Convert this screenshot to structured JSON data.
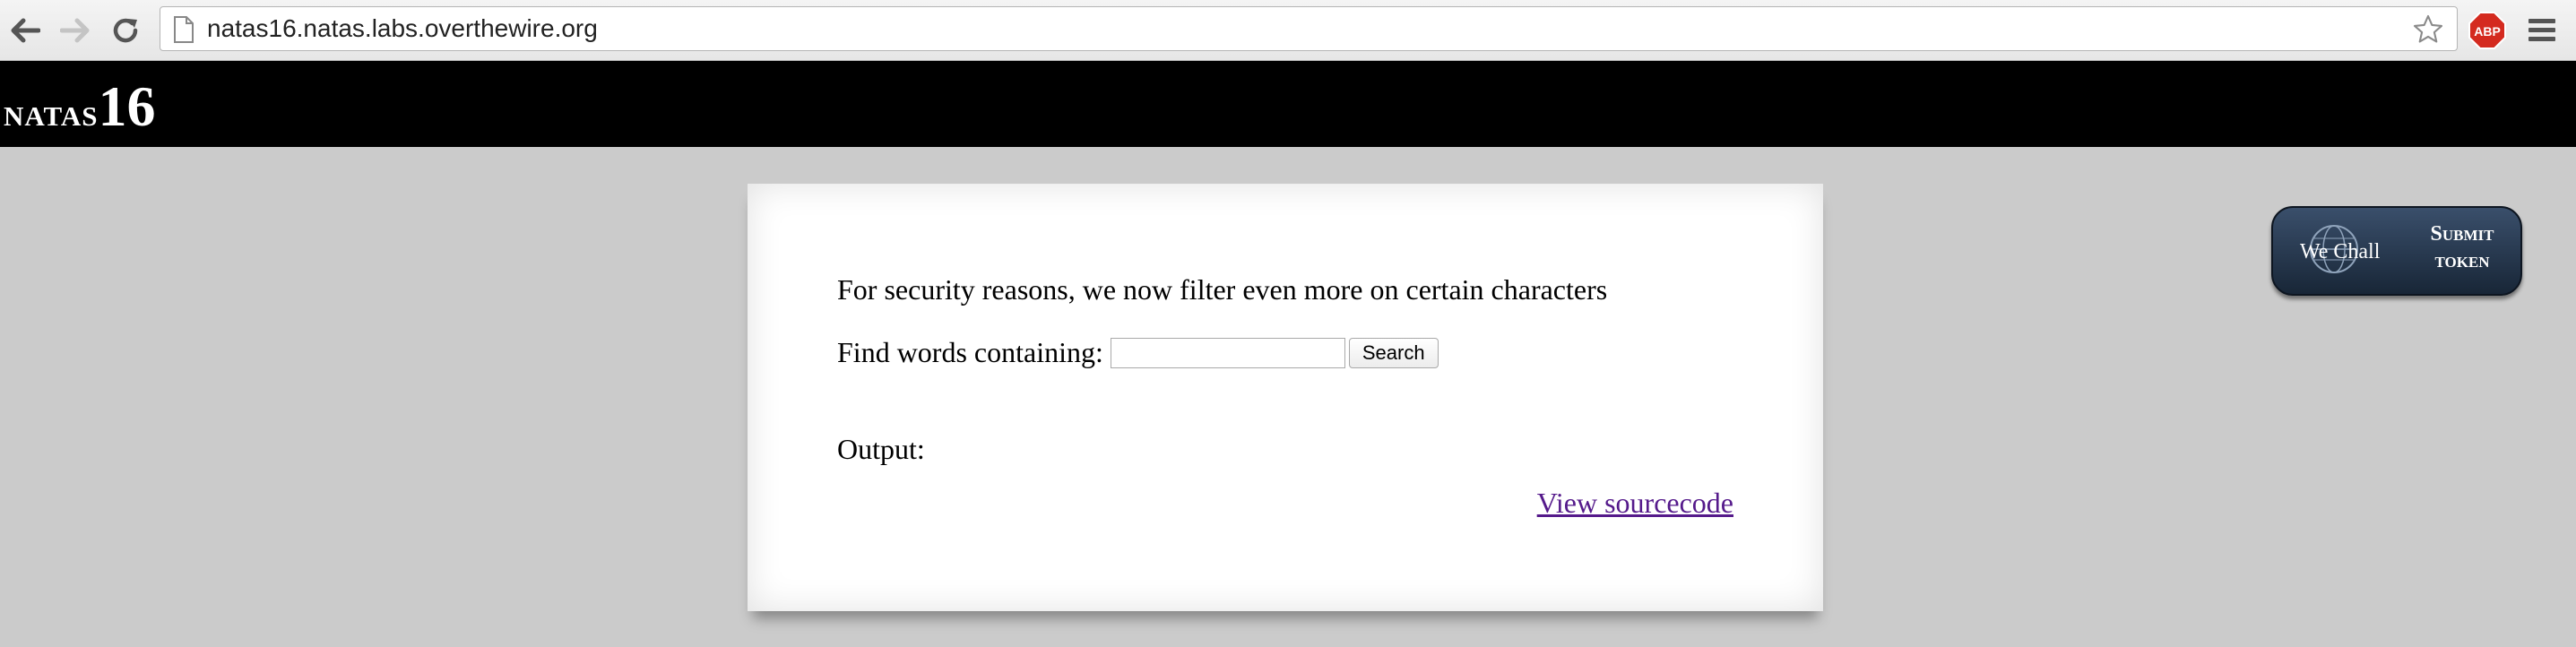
{
  "browser": {
    "url": "natas16.natas.labs.overthewire.org",
    "abp_label": "ABP"
  },
  "header": {
    "logo_name": "NATAS",
    "logo_number": "16"
  },
  "content": {
    "message": "For security reasons, we now filter even more on certain characters",
    "find_label": "Find words containing:",
    "search_value": "",
    "search_button": "Search",
    "output_label": "Output:",
    "view_source": "View sourcecode"
  },
  "wechall": {
    "brand": "We Chall",
    "submit_line1": "Submit",
    "submit_line2": "token"
  },
  "colors": {
    "page_bg": "#cbcbcb",
    "header_bg": "#000000",
    "link_visited": "#551a8b",
    "wechall_bg": "#1f2f44"
  }
}
